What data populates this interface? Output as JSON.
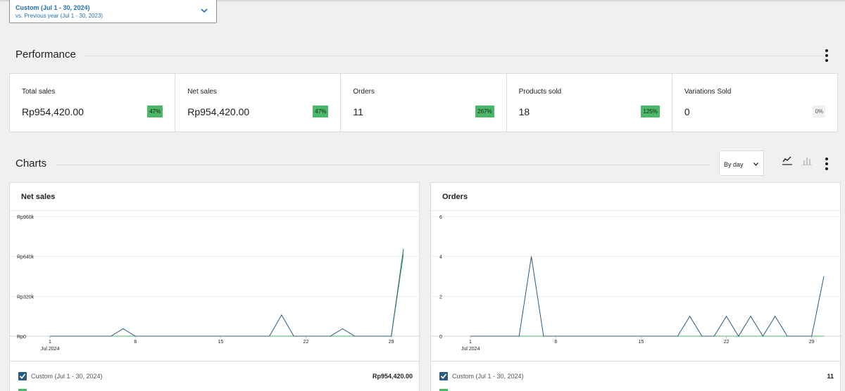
{
  "date_range": {
    "primary": "Custom (Jul 1 - 30, 2024)",
    "compare": "vs. Previous year (Jul 1 - 30, 2023)"
  },
  "performance": {
    "title": "Performance",
    "cards": [
      {
        "label": "Total sales",
        "value": "Rp954,420.00",
        "delta": "47%"
      },
      {
        "label": "Net sales",
        "value": "Rp954,420.00",
        "delta": "47%"
      },
      {
        "label": "Orders",
        "value": "11",
        "delta": "267%"
      },
      {
        "label": "Products sold",
        "value": "18",
        "delta": "125%"
      },
      {
        "label": "Variations Sold",
        "value": "0",
        "delta": "0%"
      }
    ]
  },
  "charts": {
    "title": "Charts",
    "interval": "By day"
  },
  "colors": {
    "accent": "#2271b1",
    "positive": "#4ab866",
    "primary_series": "#2c5b7e",
    "comparison_series": "#4ab866"
  },
  "chart_data": [
    {
      "type": "line",
      "title": "Net sales",
      "x_tick_labels": [
        "1",
        "8",
        "15",
        "22",
        "29"
      ],
      "x_sub_label": "Jul 2024",
      "y_tick_labels": [
        "Rp0",
        "Rp320k",
        "Rp640k",
        "Rp960k"
      ],
      "ylim": [
        0,
        960
      ],
      "y_unit": "thousand Rp",
      "series": [
        {
          "name": "Custom (Jul 1 - 30, 2024)",
          "x": [
            1,
            2,
            3,
            4,
            5,
            6,
            7,
            8,
            9,
            10,
            11,
            12,
            13,
            14,
            15,
            16,
            17,
            18,
            19,
            20,
            21,
            22,
            23,
            24,
            25,
            26,
            27,
            28,
            29,
            30
          ],
          "values": [
            0,
            0,
            0,
            0,
            0,
            0,
            60,
            0,
            0,
            0,
            0,
            0,
            0,
            0,
            0,
            0,
            0,
            0,
            0,
            170,
            0,
            0,
            0,
            0,
            60,
            0,
            0,
            0,
            0,
            700
          ]
        },
        {
          "name": "Previous year",
          "x": [
            1,
            2,
            3,
            4,
            5,
            6,
            7,
            8,
            9,
            10,
            11,
            12,
            13,
            14,
            15,
            16,
            17,
            18,
            19,
            20,
            21,
            22,
            23,
            24,
            25,
            26,
            27,
            28,
            29,
            30
          ],
          "values": [
            0,
            0,
            0,
            0,
            0,
            0,
            0,
            0,
            0,
            0,
            0,
            0,
            0,
            0,
            0,
            0,
            0,
            0,
            0,
            0,
            0,
            0,
            0,
            0,
            0,
            0,
            0,
            0,
            0,
            660
          ]
        }
      ],
      "legend": [
        {
          "label": "Custom (Jul 1 - 30, 2024)",
          "total": "Rp954,420.00"
        }
      ]
    },
    {
      "type": "line",
      "title": "Orders",
      "x_tick_labels": [
        "1",
        "8",
        "15",
        "22",
        "29"
      ],
      "x_sub_label": "Jul 2024",
      "y_tick_labels": [
        "0",
        "2",
        "4",
        "6"
      ],
      "ylim": [
        0,
        6
      ],
      "series": [
        {
          "name": "Custom (Jul 1 - 30, 2024)",
          "x": [
            1,
            2,
            3,
            4,
            5,
            6,
            7,
            8,
            9,
            10,
            11,
            12,
            13,
            14,
            15,
            16,
            17,
            18,
            19,
            20,
            21,
            22,
            23,
            24,
            25,
            26,
            27,
            28,
            29,
            30
          ],
          "values": [
            0,
            0,
            0,
            0,
            0,
            4,
            0,
            0,
            0,
            0,
            0,
            0,
            0,
            0,
            0,
            0,
            0,
            0,
            1,
            0,
            0,
            1,
            0,
            1,
            0,
            1,
            0,
            0,
            0,
            3
          ]
        },
        {
          "name": "Previous year",
          "x": [
            1,
            2,
            3,
            4,
            5,
            6,
            7,
            8,
            9,
            10,
            11,
            12,
            13,
            14,
            15,
            16,
            17,
            18,
            19,
            20,
            21,
            22,
            23,
            24,
            25,
            26,
            27,
            28,
            29,
            30
          ],
          "values": [
            0,
            0,
            0,
            0,
            0,
            0,
            0,
            0,
            0,
            0,
            0,
            0,
            0,
            0,
            0,
            0,
            0,
            0,
            0,
            0,
            0,
            0,
            0,
            0,
            0,
            0,
            0,
            0,
            0,
            0
          ]
        }
      ],
      "legend": [
        {
          "label": "Custom (Jul 1 - 30, 2024)",
          "total": "11"
        }
      ]
    }
  ]
}
